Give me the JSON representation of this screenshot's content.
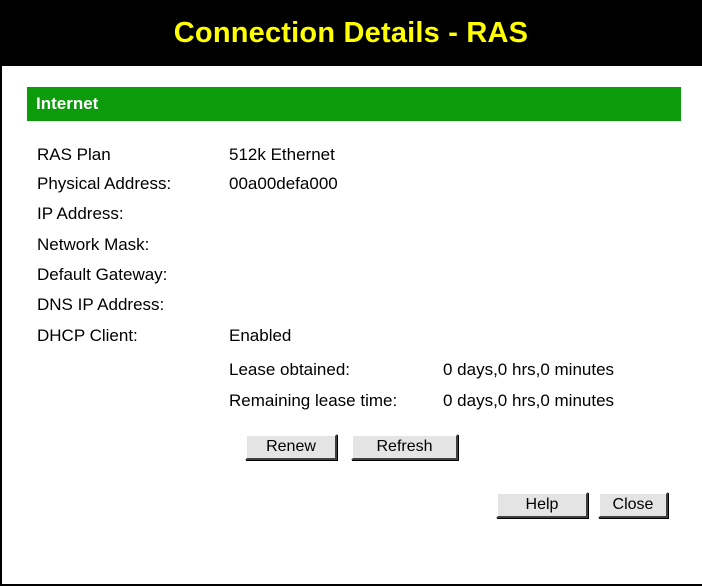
{
  "title": "Connection Details - RAS",
  "section": {
    "header": "Internet"
  },
  "fields": {
    "ras_plan_label": "RAS Plan",
    "ras_plan_value": "512k Ethernet",
    "physical_address_label": "Physical Address:",
    "physical_address_value": "00a00defa000",
    "ip_address_label": "IP Address:",
    "network_mask_label": "Network Mask:",
    "default_gateway_label": "Default Gateway:",
    "dns_ip_label": "DNS IP Address:",
    "dhcp_client_label": "DHCP Client:",
    "dhcp_client_value": "Enabled",
    "lease_obtained_label": "Lease obtained:",
    "lease_obtained_value": "0 days,0 hrs,0 minutes",
    "remaining_lease_label": "Remaining lease time:",
    "remaining_lease_value": "0 days,0 hrs,0 minutes"
  },
  "buttons": {
    "renew": "Renew",
    "refresh": "Refresh",
    "help": "Help",
    "close": "Close"
  },
  "colors": {
    "title_bg": "#000000",
    "title_fg": "#ffff00",
    "section_bg": "#0b9b0b",
    "section_fg": "#ffffff"
  }
}
